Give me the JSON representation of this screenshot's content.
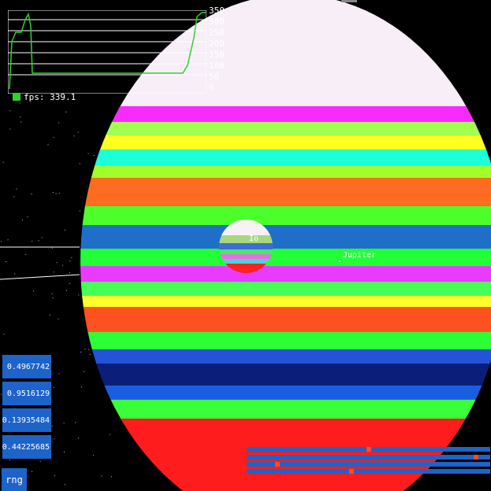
{
  "fps": {
    "label": "fps: 339.1",
    "axis_ticks": [
      "350",
      "300",
      "250",
      "200",
      "150",
      "100",
      "50",
      "0"
    ],
    "color": "#2fd12f"
  },
  "labels": {
    "planet": "Jupiter",
    "moon": "Io"
  },
  "values": [
    {
      "id": "v1",
      "text": "0.4967742"
    },
    {
      "id": "v2",
      "text": "0.9516129"
    },
    {
      "id": "v3",
      "text": "0.13935484"
    },
    {
      "id": "v4",
      "text": "0.44225685"
    }
  ],
  "rng_label": "rng",
  "sliders": [
    {
      "value": 0.5
    },
    {
      "value": 0.95
    },
    {
      "value": 0.12
    },
    {
      "value": 0.43
    }
  ],
  "colors": {
    "button": "#1d63c9",
    "thumb": "#ff4b2b"
  }
}
